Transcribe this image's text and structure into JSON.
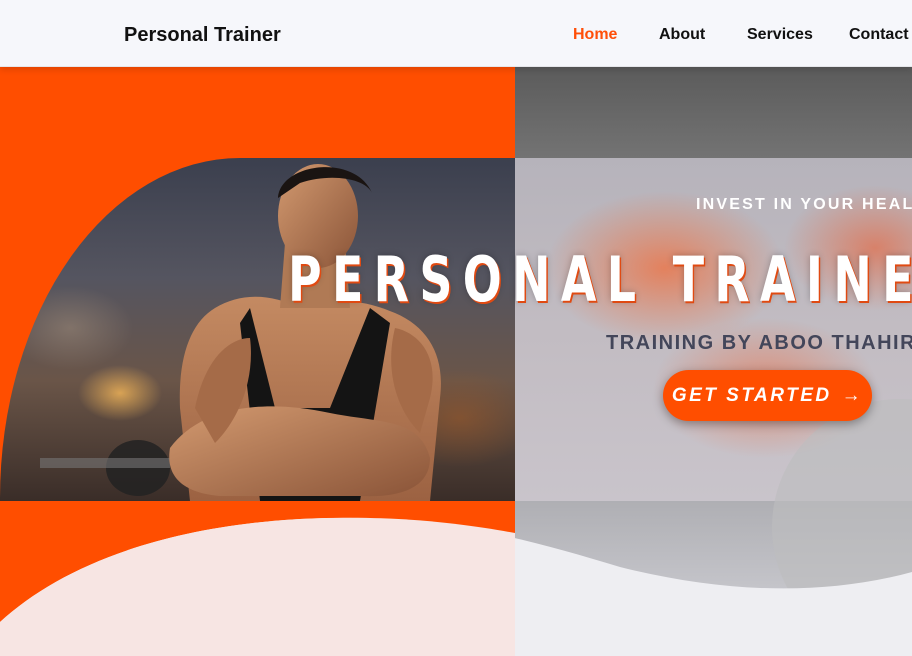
{
  "nav": {
    "brand": "Personal Trainer",
    "items": [
      {
        "label": "Home",
        "active": true
      },
      {
        "label": "About",
        "active": false
      },
      {
        "label": "Services",
        "active": false
      },
      {
        "label": "Contact",
        "active": false
      }
    ]
  },
  "hero": {
    "tagline": "INVEST IN YOUR HEALTH",
    "title": "PERSONAL TRAINER",
    "subtitle": "TRAINING BY ABOO THAHIR",
    "cta_label": "GET STARTED",
    "cta_arrow": "→"
  },
  "colors": {
    "accent": "#ff4e00",
    "nav_bg": "#f6f7fb",
    "subtitle": "#43465a"
  },
  "icons": {
    "cta_arrow": "right-arrow-icon"
  }
}
